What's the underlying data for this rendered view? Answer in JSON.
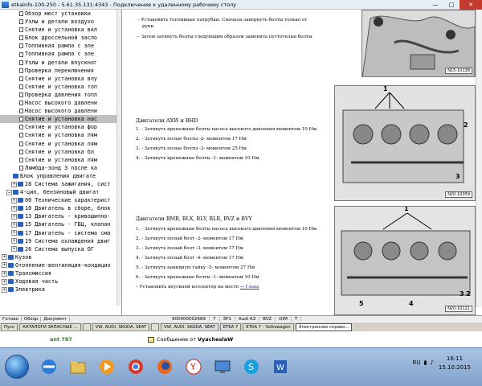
{
  "window": {
    "title": "etkainfo-100-250 - 5.61.35.131:4343 - Подключение к удаленному рабочему столу"
  },
  "tree": {
    "items": [
      {
        "label": "Обзор мест установки",
        "type": "doc"
      },
      {
        "label": "Узлы и детали воздухо",
        "type": "doc"
      },
      {
        "label": "Снятие и установка вкл",
        "type": "doc"
      },
      {
        "label": "Блок дроссельной засло",
        "type": "doc"
      },
      {
        "label": "Топливная рампа с  эле",
        "type": "doc"
      },
      {
        "label": "Топливная рампа с  эле",
        "type": "doc"
      },
      {
        "label": "Узлы и детали впускног",
        "type": "doc"
      },
      {
        "label": "Проверка переключения ",
        "type": "doc"
      },
      {
        "label": "Снятие и установка впу",
        "type": "doc"
      },
      {
        "label": "Снятие и установка топ",
        "type": "doc"
      },
      {
        "label": "Проверка давления топл",
        "type": "doc"
      },
      {
        "label": "Насос высокого давлени",
        "type": "doc"
      },
      {
        "label": "Насос высокого давлени",
        "type": "doc"
      },
      {
        "label": "Снятие и установка нас",
        "type": "doc",
        "selected": true
      },
      {
        "label": "Снятие и установка фор",
        "type": "doc"
      },
      {
        "label": "Снятие и установка лям",
        "type": "doc"
      },
      {
        "label": "Снятие и установка лям",
        "type": "doc"
      },
      {
        "label": "Снятие и установка  бл",
        "type": "doc"
      },
      {
        "label": "Снятие и установка лям",
        "type": "doc"
      },
      {
        "label": "Лямбда-зонд 3 после ка",
        "type": "doc"
      },
      {
        "label": "Блок управления двигате",
        "type": "book"
      },
      {
        "label": "28 Система зажигания, сист",
        "type": "book",
        "exp": "+"
      },
      {
        "label": "4-цил. бензиновый двигат",
        "type": "book",
        "exp": "−"
      },
      {
        "label": "00 Технические характерист",
        "type": "book",
        "exp": "+"
      },
      {
        "label": "10 Двигатель в сборе, блок",
        "type": "book",
        "exp": "+"
      },
      {
        "label": "13 Двигатель - кривошипно-",
        "type": "book",
        "exp": "+"
      },
      {
        "label": "15 Двигатель - ГБЦ, клапан",
        "type": "book",
        "exp": "+"
      },
      {
        "label": "17 Двигатель - система сма",
        "type": "book",
        "exp": "+"
      },
      {
        "label": "19 Система охлаждения двиг",
        "type": "book",
        "exp": "+"
      },
      {
        "label": "26 Система выпуска ОГ",
        "type": "book",
        "exp": "+"
      },
      {
        "label": "Кузов",
        "type": "book",
        "exp": "+"
      },
      {
        "label": "Отопление-вентиляция-кондицио",
        "type": "book",
        "exp": "+"
      },
      {
        "label": "Трансмиссия",
        "type": "book",
        "exp": "+"
      },
      {
        "label": "Ходовая часть",
        "type": "book",
        "exp": "+"
      },
      {
        "label": "Электрика",
        "type": "book",
        "exp": "+"
      }
    ],
    "tab_left": "Обзор",
    "tab_right": "Документ",
    "status_left": "Готово"
  },
  "doc": {
    "top_lines": [
      "Установить топливные патрубки. Сначала завернуть болты только от",
      "руки",
      "Затем затянуть болты следующим образом заменить пустотелые болты"
    ],
    "section1": {
      "heading": "Двигатели AXW и BHD",
      "steps": [
        "1. - Затянуть крепежные болты насоса высокого давления моментом 10 Нм.",
        "2. - Затянуть полые болты -2- моментом 17 Нм",
        "3. - Затянуть полые болты -3- моментом 25 Нм",
        "4. - Затянуть крепежные болты -1- моментом 10 Нм"
      ]
    },
    "section2": {
      "heading": "Двигатели BMB, BLX, BLY, BLR, BVZ и BVY",
      "steps": [
        "1. - Затянуть крепежные болты насоса высокого давления моментом 10 Нм.",
        "2. - Затянуть полый болт -2- моментом 17 Нм",
        "3. - Затянуть полый болт -3- моментом 17 Нм",
        "4. - Затянуть полый болт -4- моментом 17 Нм",
        "5. - Затянуть накидную гайку -5- моментом 27 Нм",
        "6. - Затянуть крепежные болты -1- моментом 10 Нм"
      ],
      "last_line_prefix": "Установить впускной коллектор на место",
      "last_line_link": "→ Глава"
    },
    "figures": {
      "fig1_caption": "N15-10138",
      "fig2_caption": "N20-10059",
      "fig2_labels": [
        "1",
        "2",
        "3"
      ],
      "fig3_caption": "N20-10121",
      "fig3_labels": [
        "1",
        "2",
        "3",
        "4",
        "5"
      ]
    },
    "status": [
      "900000002689",
      "7",
      "ЗР1",
      "Audi А3",
      "BVZ",
      "DIM",
      "T"
    ]
  },
  "inner_taskbar": [
    {
      "label": "Пуск"
    },
    {
      "label": "КАТАЛОГИ ЗАПАСНЫЕ ..."
    },
    {
      "label": ""
    },
    {
      "label": "VW, AUDI, SKODA, SEAT"
    },
    {
      "label": ""
    },
    {
      "label": "VW, AUDI, SKODA, SEAT"
    },
    {
      "label": "ETKA 7"
    },
    {
      "label": "ETKA 7 - Volkswagen"
    },
    {
      "label": "Электронное справо...",
      "active": true
    }
  ],
  "notifications": {
    "left_label": "ant 787",
    "message": "Сообщение от",
    "sender": "VyacheslaW"
  },
  "clock": {
    "time": "16:11",
    "date": "15.10.2015"
  },
  "tray": {
    "language": "RU"
  }
}
